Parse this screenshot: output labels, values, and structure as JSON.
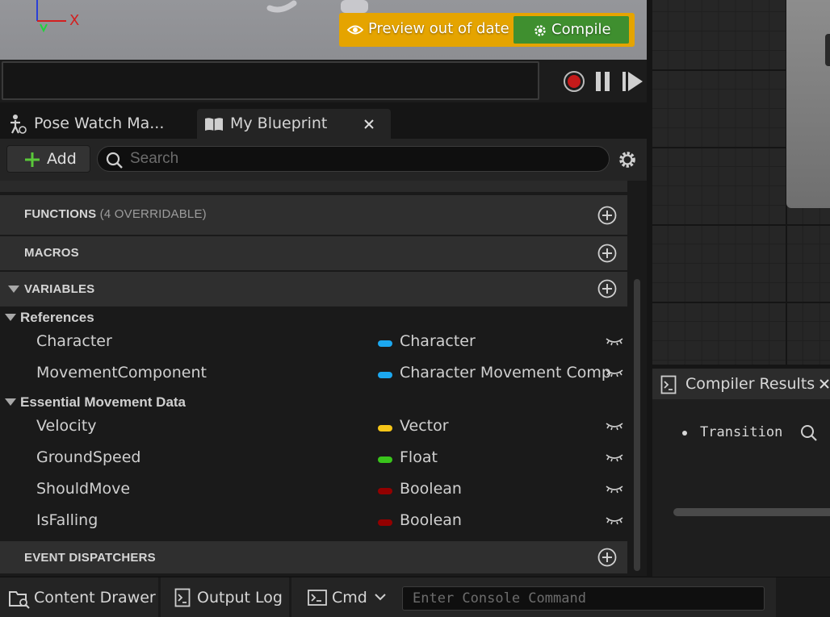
{
  "viewport": {
    "axis_x_label": "X",
    "preview_banner_text": "Preview out of date",
    "compile_label": "Compile"
  },
  "tabs": [
    {
      "label": "Pose Watch Ma...",
      "icon": "pose-watch-icon"
    },
    {
      "label": "My Blueprint",
      "icon": "book-icon",
      "closable": true
    }
  ],
  "toolbar": {
    "add_label": "Add",
    "search_placeholder": "Search"
  },
  "sections": {
    "functions": {
      "title": "FUNCTIONS",
      "subtitle": "(4 OVERRIDABLE)"
    },
    "macros": {
      "title": "MACROS"
    },
    "variables": {
      "title": "VARIABLES"
    },
    "event_dispatchers": {
      "title": "EVENT DISPATCHERS"
    }
  },
  "variable_categories": [
    {
      "name": "References",
      "variables": [
        {
          "name": "Character",
          "type": "Character",
          "type_color": "#1ca8f0"
        },
        {
          "name": "MovementComponent",
          "type": "Character Movement Comp",
          "type_color": "#1ca8f0"
        }
      ]
    },
    {
      "name": "Essential Movement Data",
      "variables": [
        {
          "name": "Velocity",
          "type": "Vector",
          "type_color": "#f5c518"
        },
        {
          "name": "GroundSpeed",
          "type": "Float",
          "type_color": "#39c41b"
        },
        {
          "name": "ShouldMove",
          "type": "Boolean",
          "type_color": "#930000"
        },
        {
          "name": "IsFalling",
          "type": "Boolean",
          "type_color": "#930000"
        }
      ]
    }
  ],
  "compiler": {
    "title": "Compiler Results",
    "message": "Transition"
  },
  "statusbar": {
    "content_drawer": "Content Drawer",
    "output_log": "Output Log",
    "cmd": "Cmd",
    "console_placeholder": "Enter Console Command"
  },
  "colors": {
    "preview_banner": "#e5a400",
    "compile_button": "#3f8f2f",
    "record_dot": "#c41a1a",
    "add_plus": "#5ac83a"
  }
}
